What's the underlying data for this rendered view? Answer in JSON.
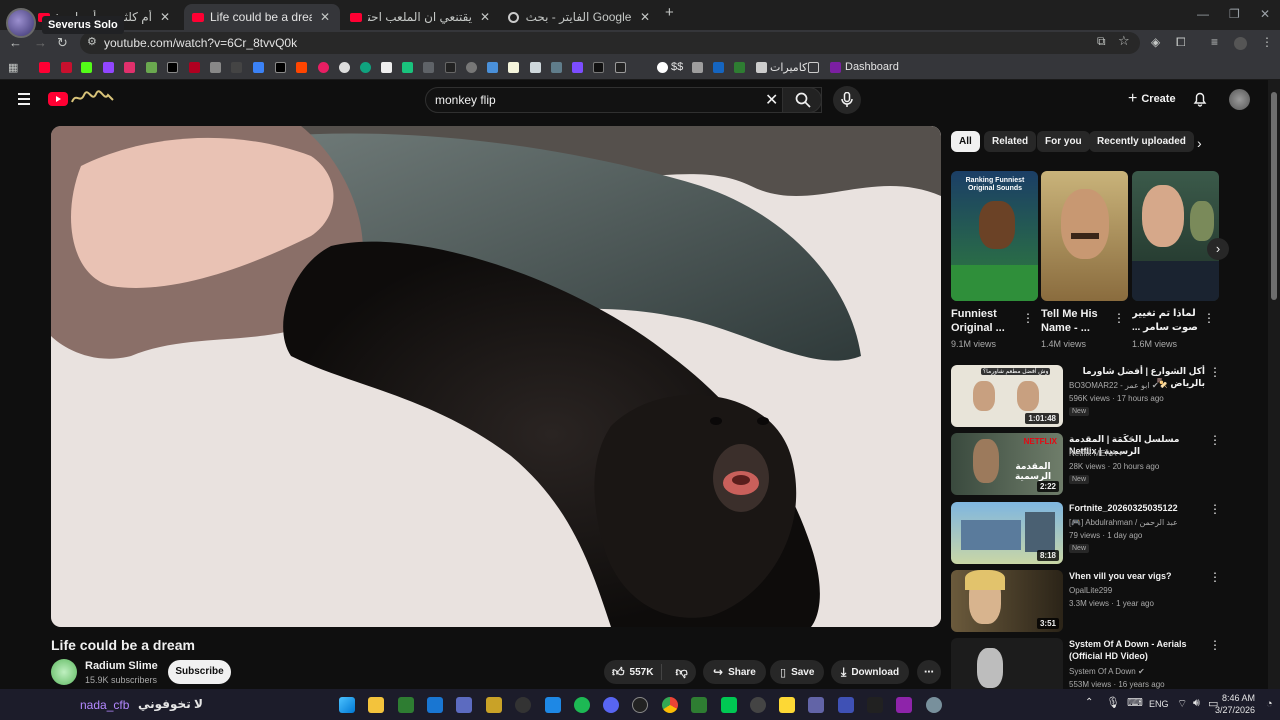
{
  "browser": {
    "tabs": [
      {
        "title": "أم كلثوم -- أجمل مقطع من أغنية",
        "active": false
      },
      {
        "title": "Life could be a dream - YouTube",
        "active": true
      },
      {
        "title": "يقتنعي ان الملعب احترق بسبب",
        "active": false
      },
      {
        "title": "الفايتر - بحث Google",
        "active": false
      }
    ],
    "profile_tooltip": "Severus Solo",
    "url": "youtube.com/watch?v=6Cr_8tvvQ0k",
    "bookmarks": {
      "dollar_label": "$$",
      "cameras_label": "كاميرات",
      "dashboard_label": "Dashboard"
    }
  },
  "yt": {
    "search_query": "monkey flip",
    "create_label": "Create",
    "video": {
      "title": "Life could be a dream",
      "channel": "Radium Slime",
      "subscribers": "15.9K subscribers",
      "subscribe_label": "Subscribe",
      "likes": "557K",
      "share_label": "Share",
      "save_label": "Save",
      "download_label": "Download"
    },
    "chips": [
      "All",
      "Related",
      "For you",
      "Recently uploaded"
    ],
    "shorts": [
      {
        "title": "Funniest Original ...",
        "views": "9.1M views",
        "thumb_text": "Ranking Funniest Original Sounds"
      },
      {
        "title": "Tell Me His Name - ...",
        "views": "1.4M views",
        "thumb_text": ""
      },
      {
        "title": "لماذا تم تغيير صوت سامر ...",
        "views": "1.6M views",
        "thumb_text": ""
      }
    ],
    "recommended": [
      {
        "title": "أكل الشوارع | أفضل شاورما بالرياض 🍢",
        "channel": "BO3OMAR22 - ابو عمر",
        "verified": true,
        "meta": "596K views · 17 hours ago",
        "new": "New",
        "duration": "1:01:48",
        "thumb_text": "وش أفضل مطعم شاورما؟"
      },
      {
        "title": "مسلسل الحَكَمَة | المقدمة الرسمية | Netflix",
        "channel": "Netflix MENA",
        "verified": true,
        "meta": "28K views · 20 hours ago",
        "new": "New",
        "duration": "2:22",
        "thumb_text": "المقدمة الرسمية"
      },
      {
        "title": "Fortnite_20260325035122",
        "channel": "[🎮] Abdulrahman / عبد الرحمن",
        "verified": false,
        "meta": "79 views · 1 day ago",
        "new": "New",
        "duration": "8:18",
        "thumb_text": ""
      },
      {
        "title": "Vhen vill you vear vigs?",
        "channel": "OpalLite299",
        "verified": false,
        "meta": "3.3M views · 1 year ago",
        "new": "",
        "duration": "3:51",
        "thumb_text": ""
      },
      {
        "title": "System Of A Down - Aerials (Official HD Video)",
        "channel": "System Of A Down",
        "verified": true,
        "meta": "553M views · 16 years ago",
        "new": "",
        "duration": "",
        "thumb_text": ""
      }
    ]
  },
  "taskbar": {
    "user_label": "nada_cfb",
    "arabic_label": "لا تخوفوني",
    "language": "ENG",
    "time": "8:46 AM",
    "date": "3/27/2026"
  },
  "colors": {
    "yt_red": "#ff0033",
    "bg": "#0f0f0f"
  }
}
